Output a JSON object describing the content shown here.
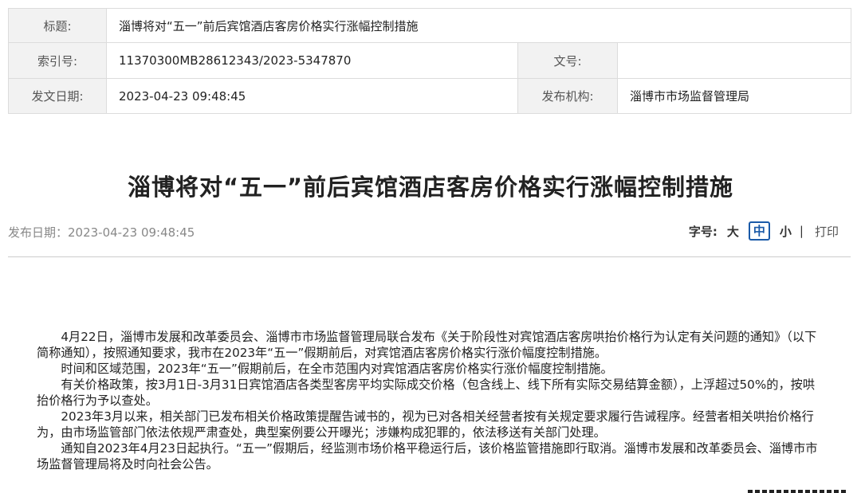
{
  "meta": {
    "title_label": "标题:",
    "title_value": "淄博将对“五一”前后宾馆酒店客房价格实行涨幅控制措施",
    "index_label": "索引号:",
    "index_value": "11370300MB28612343/2023-5347870",
    "docno_label": "文号:",
    "docno_value": "",
    "date_label": "发文日期:",
    "date_value": "2023-04-23 09:48:45",
    "org_label": "发布机构:",
    "org_value": "淄博市市场监督管理局"
  },
  "article": {
    "title": "淄博将对“五一”前后宾馆酒店客房价格实行涨幅控制措施",
    "pubdate": "发布日期：2023-04-23 09:48:45"
  },
  "toolbar": {
    "fontsize_label": "字号:",
    "large": "大",
    "medium": "中",
    "small": "小",
    "separator": "|",
    "print": "打印"
  },
  "body": {
    "paragraphs": [
      "4月22日，淄博市发展和改革委员会、淄博市市场监督管理局联合发布《关于阶段性对宾馆酒店客房哄抬价格行为认定有关问题的通知》（以下简称通知），按照通知要求，我市在2023年“五一”假期前后，对宾馆酒店客房价格实行涨价幅度控制措施。",
      "时间和区域范围，2023年“五一”假期前后，在全市范围内对宾馆酒店客房价格实行涨价幅度控制措施。",
      "有关价格政策，按3月1日-3月31日宾馆酒店各类型客房平均实际成交价格（包含线上、线下所有实际交易结算金额），上浮超过50%的，按哄抬价格行为予以查处。",
      "2023年3月以来，相关部门已发布相关价格政策提醒告诫书的，视为已对各相关经营者按有关规定要求履行告诫程序。经营者相关哄抬价格行为，由市场监管部门依法依规严肃查处，典型案例要公开曝光；涉嫌构成犯罪的，依法移送有关部门处理。",
      "通知自2023年4月23日起执行。“五一”假期后，经监测市场价格平稳运行后，该价格监管措施即行取消。淄博市发展和改革委员会、淄博市市场监督管理局将及时向社会公告。"
    ]
  }
}
